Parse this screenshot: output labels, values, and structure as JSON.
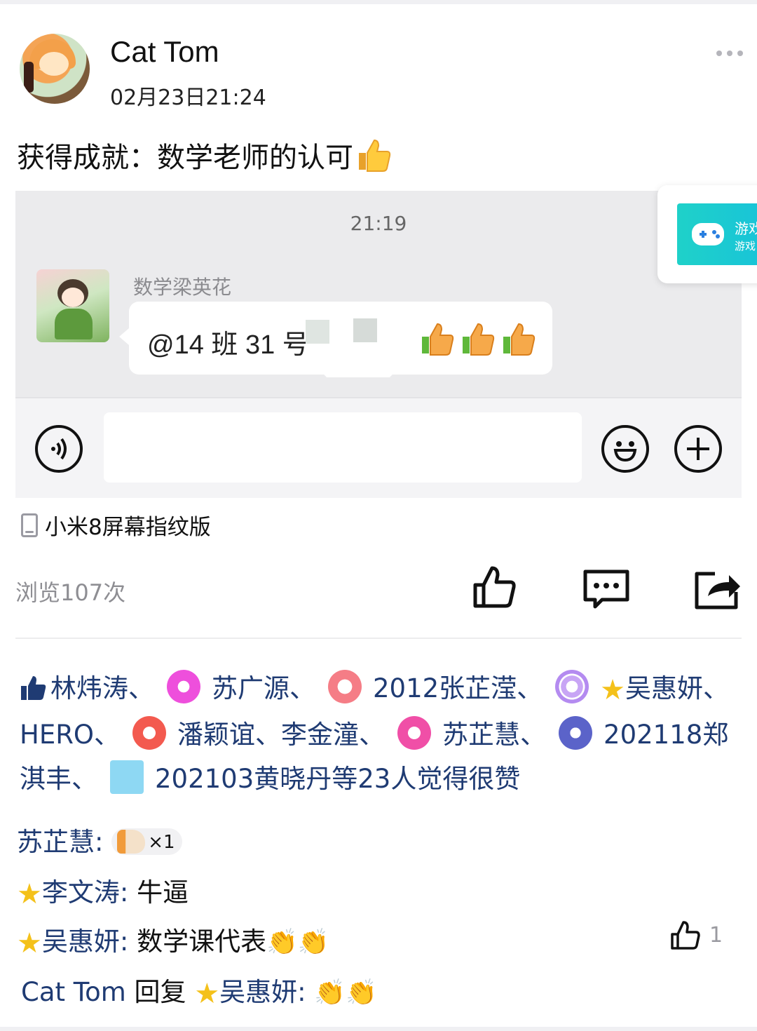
{
  "post": {
    "username": "Cat Tom",
    "timestamp": "02月23日21:24",
    "text": "获得成就：数学老师的认可",
    "device": "小米8屏幕指纹版",
    "views": "浏览107次"
  },
  "screenshot": {
    "time": "21:19",
    "sender": "数学梁英花",
    "message": "@14 班 31 号",
    "popup_title": "游戏",
    "popup_subtitle": "游戏"
  },
  "likes": {
    "names": [
      "林炜涛、",
      "苏广源、",
      "2012张芷滢、",
      "吴惠妍、",
      "HERO、",
      "潘颖谊、李金潼、",
      "苏芷慧、",
      "202118郑淇丰、",
      "202103黄晓丹等23人觉得很赞"
    ]
  },
  "comments": [
    {
      "name": "苏芷慧:",
      "sticker_count": "×1"
    },
    {
      "name": "李文涛:",
      "text": "牛逼"
    },
    {
      "name": "吴惠妍:",
      "text": "数学课代表",
      "likes": "1"
    },
    {
      "name": "Cat Tom",
      "reply_word": "回复",
      "reply_to": "吴惠妍:"
    }
  ],
  "colors": {
    "link": "#1f3b73",
    "muted": "#8e8e93",
    "star": "#f4c11a"
  }
}
